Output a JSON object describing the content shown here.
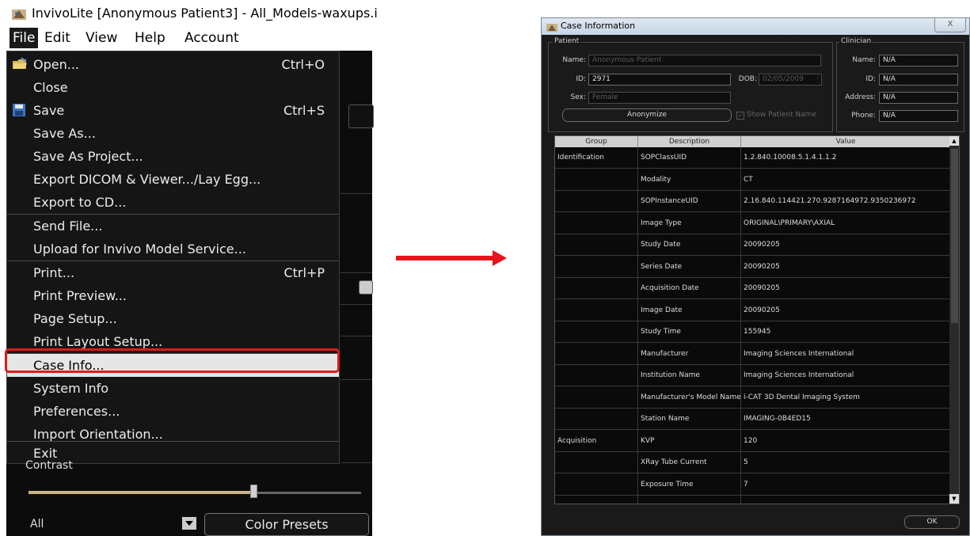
{
  "app": {
    "title": "InvivoLite [Anonymous Patient3] - All_Models-waxups.i",
    "menubar": [
      "File",
      "Edit",
      "View",
      "Help",
      "Account"
    ],
    "file_menu": [
      {
        "label": "Open...",
        "shortcut": "Ctrl+O",
        "icon": "folder-open-icon"
      },
      {
        "label": "Close",
        "shortcut": ""
      },
      {
        "label": "Save",
        "shortcut": "Ctrl+S",
        "icon": "save-disk-icon"
      },
      {
        "label": "Save As...",
        "shortcut": ""
      },
      {
        "label": "Save As Project...",
        "shortcut": ""
      },
      {
        "label": "Export DICOM & Viewer.../Lay Egg...",
        "shortcut": ""
      },
      {
        "label": "Export to CD...",
        "shortcut": ""
      },
      {
        "label": "Send File...",
        "shortcut": ""
      },
      {
        "label": "Upload for Invivo Model Service...",
        "shortcut": ""
      },
      {
        "label": "Print...",
        "shortcut": "Ctrl+P"
      },
      {
        "label": "Print Preview...",
        "shortcut": ""
      },
      {
        "label": "Page Setup...",
        "shortcut": ""
      },
      {
        "label": "Print Layout Setup...",
        "shortcut": ""
      },
      {
        "label": "Case Info...",
        "shortcut": "",
        "highlighted": true
      },
      {
        "label": "System Info",
        "shortcut": ""
      },
      {
        "label": "Preferences...",
        "shortcut": ""
      },
      {
        "label": "Import Orientation...",
        "shortcut": ""
      },
      {
        "label": "Exit",
        "shortcut": ""
      }
    ],
    "contrast_label": "Contrast",
    "group_select_value": "All",
    "color_presets_label": "Color Presets",
    "highlight_color": "#e01a1a"
  },
  "dialog": {
    "title": "Case Information",
    "close_label": "X",
    "patient": {
      "group_label": "Patient",
      "name_label": "Name:",
      "name_value": "Anonymous Patient",
      "id_label": "ID:",
      "id_value": "2971",
      "dob_label": "DOB:",
      "dob_value": "02/05/2009",
      "sex_label": "Sex:",
      "sex_value": "Female",
      "anonymize_label": "Anonymize",
      "show_name_label": "Show Patient Name"
    },
    "clinician": {
      "group_label": "Clinician",
      "name_label": "Name:",
      "name_value": "N/A",
      "id_label": "ID:",
      "id_value": "N/A",
      "address_label": "Address:",
      "address_value": "N/A",
      "phone_label": "Phone:",
      "phone_value": "N/A"
    },
    "table": {
      "headers": [
        "Group",
        "Description",
        "Value"
      ],
      "rows": [
        [
          "Identification",
          "SOPClassUID",
          "1.2.840.10008.5.1.4.1.1.2"
        ],
        [
          "",
          "Modality",
          "CT"
        ],
        [
          "",
          "SOPInstanceUID",
          "2.16.840.114421.270.9287164972.9350236972"
        ],
        [
          "",
          "Image Type",
          "ORIGINAL\\PRIMARY\\AXIAL"
        ],
        [
          "",
          "Study Date",
          "20090205"
        ],
        [
          "",
          "Series Date",
          "20090205"
        ],
        [
          "",
          "Acquisition Date",
          "20090205"
        ],
        [
          "",
          "Image Date",
          "20090205"
        ],
        [
          "",
          "Study Time",
          "155945"
        ],
        [
          "",
          "Manufacturer",
          "Imaging Sciences International"
        ],
        [
          "",
          "Institution Name",
          "Imaging Sciences International"
        ],
        [
          "",
          "Manufacturer's Model Name",
          "i-CAT 3D Dental Imaging System"
        ],
        [
          "",
          "Station Name",
          "IMAGING-0B4ED15"
        ],
        [
          "Acquisition",
          "KVP",
          "120"
        ],
        [
          "",
          "XRay Tube Current",
          "5"
        ],
        [
          "",
          "Exposure Time",
          "7"
        ]
      ]
    },
    "ok_label": "OK"
  },
  "arrow_color": "#e8141b"
}
